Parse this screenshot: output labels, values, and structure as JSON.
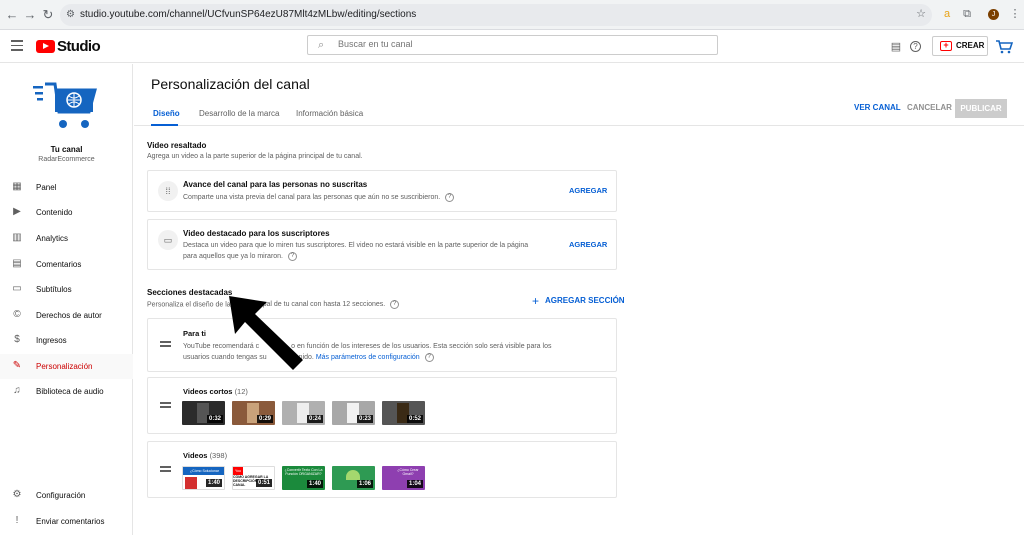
{
  "browser": {
    "url": "studio.youtube.com/channel/UCfvunSP64ezU87Mlt4zMLbw/editing/sections"
  },
  "header": {
    "logo_text": "Studio",
    "search_placeholder": "Buscar en tu canal",
    "create_label": "CREAR"
  },
  "sidebar": {
    "channel_label": "Tu canal",
    "channel_handle": "RadarEcommerce",
    "items": [
      {
        "label": "Panel",
        "icon": "dashboard-icon"
      },
      {
        "label": "Contenido",
        "icon": "content-icon"
      },
      {
        "label": "Analytics",
        "icon": "analytics-icon"
      },
      {
        "label": "Comentarios",
        "icon": "comments-icon"
      },
      {
        "label": "Subtítulos",
        "icon": "subtitles-icon"
      },
      {
        "label": "Derechos de autor",
        "icon": "copyright-icon"
      },
      {
        "label": "Ingresos",
        "icon": "earn-icon"
      },
      {
        "label": "Personalización",
        "icon": "customization-icon",
        "active": true
      },
      {
        "label": "Biblioteca de audio",
        "icon": "audio-library-icon"
      }
    ],
    "bottom_items": [
      {
        "label": "Configuración",
        "icon": "settings-icon"
      },
      {
        "label": "Enviar comentarios",
        "icon": "feedback-icon"
      }
    ]
  },
  "main": {
    "title": "Personalización del canal",
    "tabs": [
      "Diseño",
      "Desarrollo de la marca",
      "Información básica"
    ],
    "active_tab": "Diseño",
    "view_channel": "VER CANAL",
    "cancel": "CANCELAR",
    "publish": "PUBLICAR",
    "featured_video": {
      "title": "Video resaltado",
      "desc": "Agrega un video a la parte superior de la página principal de tu canal.",
      "cards": [
        {
          "title": "Avance del canal para las personas no suscritas",
          "text": "Comparte una vista previa del canal para las personas que aún no se suscribieron.",
          "action": "AGREGAR"
        },
        {
          "title": "Video destacado para los suscriptores",
          "text": "Destaca un video para que lo miren tus suscriptores. El video no estará visible en la parte superior de la página para aquellos que ya lo miraron.",
          "action": "AGREGAR"
        }
      ]
    },
    "featured_sections": {
      "title": "Secciones destacadas",
      "desc_start": "Personaliza el diseño de la",
      "desc_end": "pal de tu canal con hasta 12 secciones.",
      "add_label": "AGREGAR SECCIÓN",
      "for_you": {
        "title": "Para ti",
        "text_a": "YouTube recomendará c",
        "text_b": "o en función de los intereses de los usuarios. Esta sección solo será visible para los",
        "text_c": "usuarios cuando tengas su",
        "text_d": "nido.",
        "link": "Más parámetros de configuración"
      },
      "shorts": {
        "title": "Videos cortos",
        "count": "(12)",
        "durations": [
          "0:32",
          "0:29",
          "0:24",
          "0:23",
          "0:52"
        ]
      },
      "videos": {
        "title": "Videos",
        "count": "(398)",
        "durations": [
          "1:40",
          "0:51",
          "1:40",
          "1:06",
          "1:04"
        ],
        "thumb_texts": [
          "¿Cómo Solucionar Problemas?",
          "CÓMO AGREGAR LA DESCRIPCIÓN DEL CANAL",
          "¿Convertir Texto Con La Función ORGANIZAR?",
          "",
          "¿Cómo Crear Gmail?"
        ]
      }
    }
  }
}
